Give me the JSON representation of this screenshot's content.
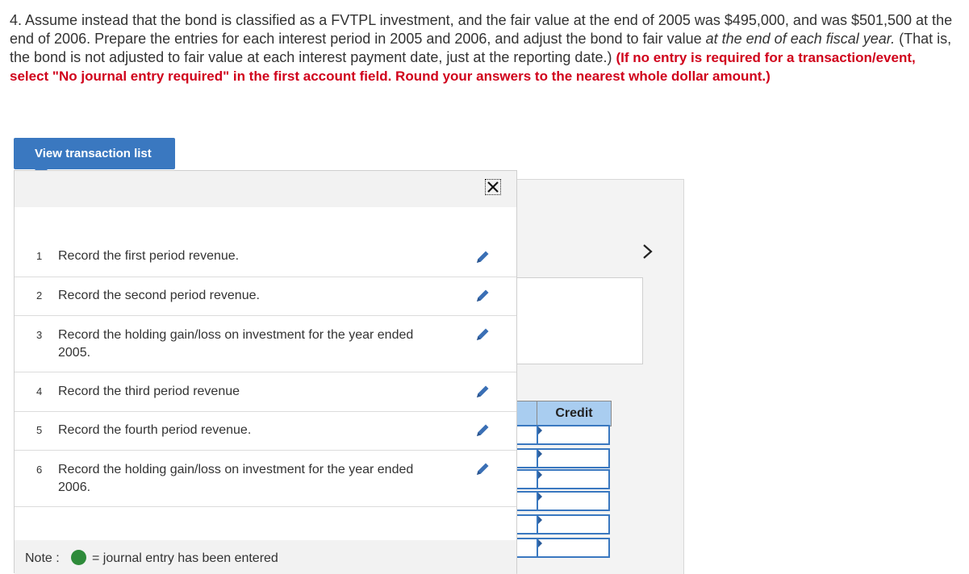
{
  "question": {
    "part1": "4. Assume instead that the bond is classified as a FVTPL investment, and the fair value at the end of 2005 was $495,000, and was $501,500 at the end of 2006. Prepare the entries for each interest period in 2005 and 2006, and adjust the bond to fair value ",
    "italic": "at the end of each fiscal year.",
    "part2": " (That is, the bond is not adjusted to fair value at each interest payment date, just at the reporting date.) ",
    "instructions": "(If no entry is required for a transaction/event, select \"No journal entry required\" in the first account field. Round your answers to the nearest whole dollar amount.)"
  },
  "view_button_label": "View transaction list",
  "transactions": [
    {
      "num": "1",
      "text": "Record the first period revenue."
    },
    {
      "num": "2",
      "text": "Record the second period revenue."
    },
    {
      "num": "3",
      "text": "Record the holding gain/loss on investment for the year ended 2005."
    },
    {
      "num": "4",
      "text": "Record the third period revenue"
    },
    {
      "num": "5",
      "text": "Record the fourth period revenue."
    },
    {
      "num": "6",
      "text": "Record the holding gain/loss on investment for the year ended 2006."
    }
  ],
  "note": {
    "label": "Note :",
    "legend": "= journal entry has been entered",
    "dot_color": "#2e8b3a"
  },
  "journal": {
    "credit_header": "Credit",
    "next_icon": "chevron-right-icon"
  },
  "colors": {
    "accent": "#3a78c0",
    "instruction_red": "#d0021b",
    "credit_header_bg": "#a9cdf0"
  }
}
